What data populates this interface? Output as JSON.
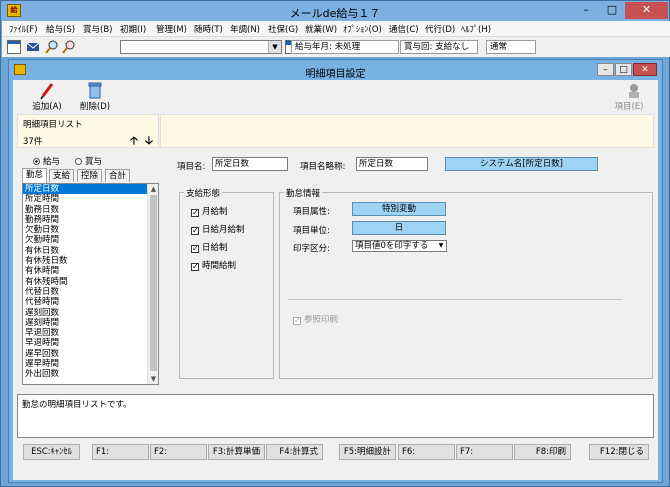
{
  "app": {
    "title": "メールde給与１７"
  },
  "menu": [
    "ﾌｧｲﾙ(F)",
    "給与(S)",
    "賞与(B)",
    "初期(I)",
    "管理(M)",
    "随時(T)",
    "年調(N)",
    "社保(G)",
    "就業(W)",
    "ｵﾌﾟｼｮﾝ(O)",
    "通信(C)",
    "代行(D)",
    "ﾍﾙﾌﾟ(H)"
  ],
  "toolbar": {
    "combo_value": "",
    "pay_month": "給与年月: 未処理",
    "bonus_count": "賞与回: 支給なし",
    "mode": "通常"
  },
  "window": {
    "title": "明細項目設定"
  },
  "actions": {
    "add": "追加(A)",
    "delete": "削除(D)",
    "item": "項目(E)"
  },
  "list": {
    "title": "明細項目リスト",
    "count": "37件",
    "radio_pay": "給与",
    "radio_bonus": "賞与",
    "radio_selected": "pay",
    "tabs": [
      "勤怠",
      "支給",
      "控除",
      "合計"
    ],
    "active_tab": 0,
    "items": [
      "所定日数",
      "所定時間",
      "勤務日数",
      "勤務時間",
      "欠勤日数",
      "欠勤時間",
      "有休日数",
      "有休残日数",
      "有休時間",
      "有休残時間",
      "代替日数",
      "代替時間",
      "遅刻回数",
      "遅刻時間",
      "早退回数",
      "早退時間",
      "遅早回数",
      "遅早時間",
      "外出回数"
    ],
    "selected_index": 0
  },
  "detail": {
    "item_name_label": "項目名:",
    "item_name": "所定日数",
    "short_name_label": "項目名略称:",
    "short_name": "所定日数",
    "system_name": "システム名[所定日数]",
    "pay_type": {
      "title": "支給形態",
      "options": [
        {
          "label": "月給制",
          "checked": true
        },
        {
          "label": "日給月給制",
          "checked": true
        },
        {
          "label": "日給制",
          "checked": true
        },
        {
          "label": "時間給制",
          "checked": true
        }
      ]
    },
    "attendance": {
      "title": "勤怠情報",
      "attr_label": "項目属性:",
      "attr_value": "特別変動",
      "unit_label": "項目単位:",
      "unit_value": "日",
      "print_label": "印字区分:",
      "print_value": "項目値0を印字する",
      "ref_print_label": "参照印刷",
      "ref_print_checked": true
    }
  },
  "status": {
    "message": "勤怠の明細項目リストです。"
  },
  "fkeys": [
    "ESC:ｷｬﾝｾﾙ",
    "F1:",
    "F2:",
    "F3:計算単価",
    "F4:計算式",
    "F5:明細設計",
    "F6:",
    "F7:",
    "F8:印刷",
    "F12:閉じる"
  ],
  "colors": {
    "titlebar": "#7bb0e0",
    "accent_blue": "#9fd3f3",
    "selection": "#0078d7",
    "info_bg": "#fdf9e5"
  }
}
